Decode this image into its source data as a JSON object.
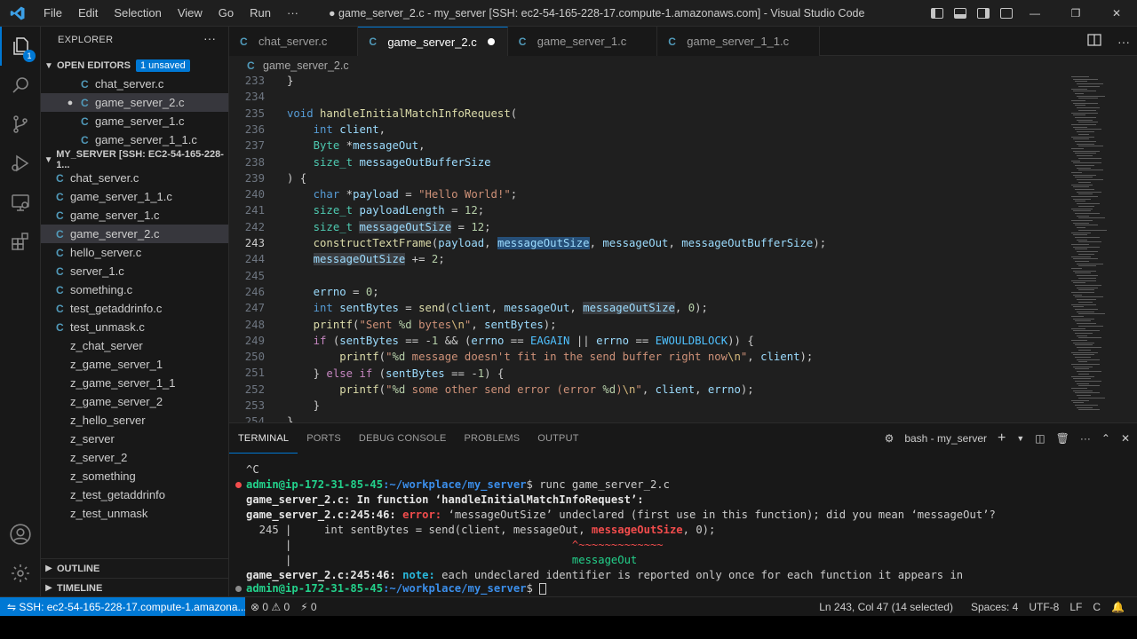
{
  "titlebar": {
    "menus": [
      "File",
      "Edit",
      "Selection",
      "View",
      "Go",
      "Run",
      "···"
    ],
    "window_title": "● game_server_2.c - my_server [SSH: ec2-54-165-228-17.compute-1.amazonaws.com] - Visual Studio Code"
  },
  "explorer": {
    "title": "EXPLORER",
    "more": "···",
    "open_editors": {
      "header": "OPEN EDITORS",
      "badge": "1 unsaved",
      "items": [
        "chat_server.c",
        "game_server_2.c",
        "game_server_1.c",
        "game_server_1_1.c"
      ]
    },
    "folder": {
      "header": "MY_SERVER [SSH: EC2-54-165-228-1...",
      "items": [
        "chat_server.c",
        "game_server_1_1.c",
        "game_server_1.c",
        "game_server_2.c",
        "hello_server.c",
        "server_1.c",
        "something.c",
        "test_getaddrinfo.c",
        "test_unmask.c",
        "z_chat_server",
        "z_game_server_1",
        "z_game_server_1_1",
        "z_game_server_2",
        "z_hello_server",
        "z_server",
        "z_server_2",
        "z_something",
        "z_test_getaddrinfo",
        "z_test_unmask"
      ]
    },
    "outline": "OUTLINE",
    "timeline": "TIMELINE"
  },
  "tabs": [
    {
      "label": "chat_server.c"
    },
    {
      "label": "game_server_2.c"
    },
    {
      "label": "game_server_1.c"
    },
    {
      "label": "game_server_1_1.c"
    }
  ],
  "breadcrumb": "game_server_2.c",
  "editor": {
    "line_numbers": [
      "233",
      "234",
      "235",
      "236",
      "237",
      "238",
      "239",
      "240",
      "241",
      "242",
      "243",
      "244",
      "245",
      "246",
      "247",
      "248",
      "249",
      "250",
      "251",
      "252",
      "253",
      "254"
    ]
  },
  "panel": {
    "tabs": [
      "TERMINAL",
      "PORTS",
      "DEBUG CONSOLE",
      "PROBLEMS",
      "OUTPUT"
    ],
    "terminal_name": "bash - my_server",
    "lines": {
      "l1": "^C",
      "prompt_user": "admin@ip-172-31-85-45",
      "prompt_path": ":~/workplace/my_server",
      "prompt_end": "$ ",
      "cmd": "runc game_server_2.c",
      "l3": "game_server_2.c: In function ‘handleInitialMatchInfoRequest’:",
      "l4_loc": "game_server_2.c:245:46: ",
      "l4_err": "error: ",
      "l4_msg": "‘messageOutSize’ undeclared (first use in this function); did you mean ‘messageOut’?",
      "l5_num": "  245 |",
      "l5_code_a": "     int sentBytes = send(client, messageOut, ",
      "l5_code_b": "messageOutSize",
      "l5_code_c": ", 0);",
      "l6_bar": "      |",
      "l6_tilde": "^~~~~~~~~~~~~~",
      "l7_bar": "      |",
      "l7_sugg": "messageOut",
      "l8_loc": "game_server_2.c:245:46: ",
      "l8_note": "note: ",
      "l8_msg": "each undeclared identifier is reported only once for each function it appears in"
    }
  },
  "statusbar": {
    "remote": "SSH: ec2-54-165-228-17.compute-1.amazona...",
    "errors": "⊗ 0 ⚠ 0",
    "ports": "⚡ 0",
    "position": "Ln 243, Col 47 (14 selected)",
    "spaces": "Spaces: 4",
    "encoding": "UTF-8",
    "eol": "LF",
    "language": "C"
  }
}
